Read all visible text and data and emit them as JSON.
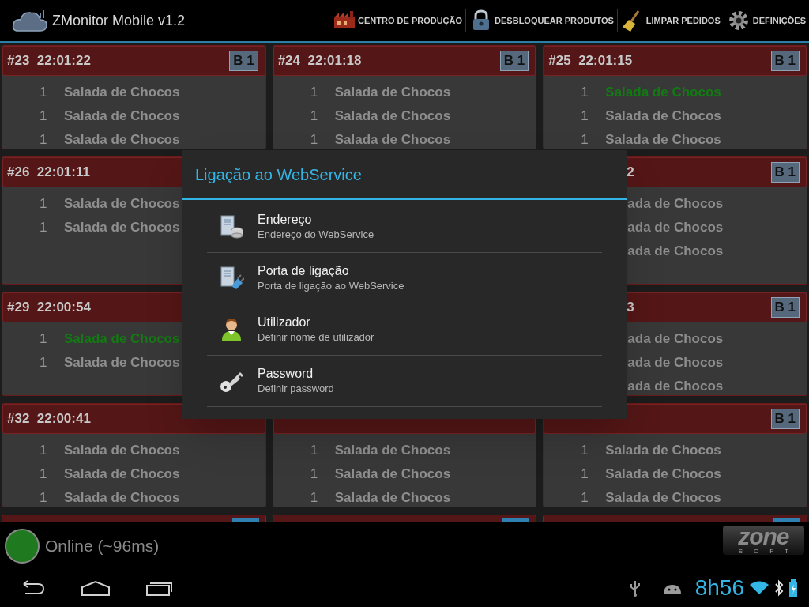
{
  "app_bar": {
    "title": "ZMonitor Mobile v1.2",
    "actions": [
      {
        "kind": "factory",
        "label": "CENTRO DE PRODUÇÃO"
      },
      {
        "kind": "lock",
        "label": "DESBLOQUEAR PRODUTOS"
      },
      {
        "kind": "broom",
        "label": "LIMPAR PEDIDOS"
      },
      {
        "kind": "gear",
        "label": "DEFINIÇÕES"
      }
    ]
  },
  "order_rows": [
    {
      "cards": [
        {
          "kind": "full",
          "header": "#23  22:01:22",
          "badge": "B 1",
          "items": [
            {
              "qty": "1",
              "name": "Salada de Chocos",
              "ready": false
            },
            {
              "qty": "1",
              "name": "Salada de Chocos",
              "ready": false
            },
            {
              "qty": "1",
              "name": "Salada de Chocos",
              "ready": false
            }
          ]
        },
        {
          "kind": "full",
          "header": "#24  22:01:18",
          "badge": "B 1",
          "items": [
            {
              "qty": "1",
              "name": "Salada de Chocos",
              "ready": false
            },
            {
              "qty": "1",
              "name": "Salada de Chocos",
              "ready": false
            },
            {
              "qty": "1",
              "name": "Salada de Chocos",
              "ready": false
            }
          ]
        },
        {
          "kind": "full",
          "header": "#25  22:01:15",
          "badge": "B 1",
          "items": [
            {
              "qty": "1",
              "name": "Salada de Chocos",
              "ready": true
            },
            {
              "qty": "1",
              "name": "Salada de Chocos",
              "ready": false
            },
            {
              "qty": "1",
              "name": "Salada de Chocos",
              "ready": false
            }
          ]
        }
      ]
    },
    {
      "cards": [
        {
          "kind": "left_part",
          "header": "#26  22:01:11",
          "items": [
            {
              "qty": "1",
              "name": "Salada de Chocos",
              "ready": false
            },
            {
              "qty": "1",
              "name": "Salada de Chocos",
              "ready": false
            }
          ]
        },
        {
          "kind": "right_part",
          "header": "2",
          "badge": "B 1",
          "items": [
            {
              "name": "ada de Chocos",
              "ready": false
            },
            {
              "name": "ada de Chocos",
              "ready": false
            },
            {
              "name": "ada de Chocos",
              "ready": false
            }
          ]
        }
      ]
    },
    {
      "cards": [
        {
          "kind": "left_part",
          "header": "#29  22:00:54",
          "items": [
            {
              "qty": "1",
              "name": "Salada de Chocos",
              "ready": true
            },
            {
              "qty": "1",
              "name": "Salada de Chocos",
              "ready": false
            }
          ]
        },
        {
          "kind": "right_part",
          "header": "3",
          "badge": "B 1",
          "items": [
            {
              "name": "ada de Chocos",
              "ready": false
            },
            {
              "name": "ada de Chocos",
              "ready": false
            },
            {
              "name": "ada de Chocos",
              "ready": false
            }
          ]
        }
      ]
    },
    {
      "cards": [
        {
          "kind": "full",
          "header": "#32  22:00:41",
          "items": [
            {
              "qty": "1",
              "name": "Salada de Chocos",
              "ready": false
            },
            {
              "qty": "1",
              "name": "Salada de Chocos",
              "ready": false
            },
            {
              "qty": "1",
              "name": "Salada de Chocos",
              "ready": false
            }
          ]
        },
        {
          "kind": "full",
          "items": [
            {
              "qty": "1",
              "name": "Salada de Chocos",
              "ready": false
            },
            {
              "qty": "1",
              "name": "Salada de Chocos",
              "ready": false
            },
            {
              "qty": "1",
              "name": "Salada de Chocos",
              "ready": false
            }
          ]
        },
        {
          "kind": "full",
          "badge": "B 1",
          "items": [
            {
              "qty": "1",
              "name": "Salada de Chocos",
              "ready": false
            },
            {
              "qty": "1",
              "name": "Salada de Chocos",
              "ready": false
            },
            {
              "qty": "1",
              "name": "Salada de Chocos",
              "ready": false
            }
          ]
        }
      ]
    }
  ],
  "dialog": {
    "title": "Ligação ao WebService",
    "items": [
      {
        "kind": "server",
        "title": "Endereço",
        "summary": "Endereço do WebService"
      },
      {
        "kind": "plug",
        "title": "Porta de ligação",
        "summary": "Porta de ligação ao WebService"
      },
      {
        "kind": "user",
        "title": "Utilizador",
        "summary": "Definir nome de utilizador"
      },
      {
        "kind": "key",
        "title": "Password",
        "summary": "Definir password"
      }
    ]
  },
  "status": {
    "online": true,
    "text": "Online (~96ms)"
  },
  "logo": {
    "word": "zone",
    "sub": "SOFT"
  },
  "system_bar": {
    "time": "8h56"
  }
}
